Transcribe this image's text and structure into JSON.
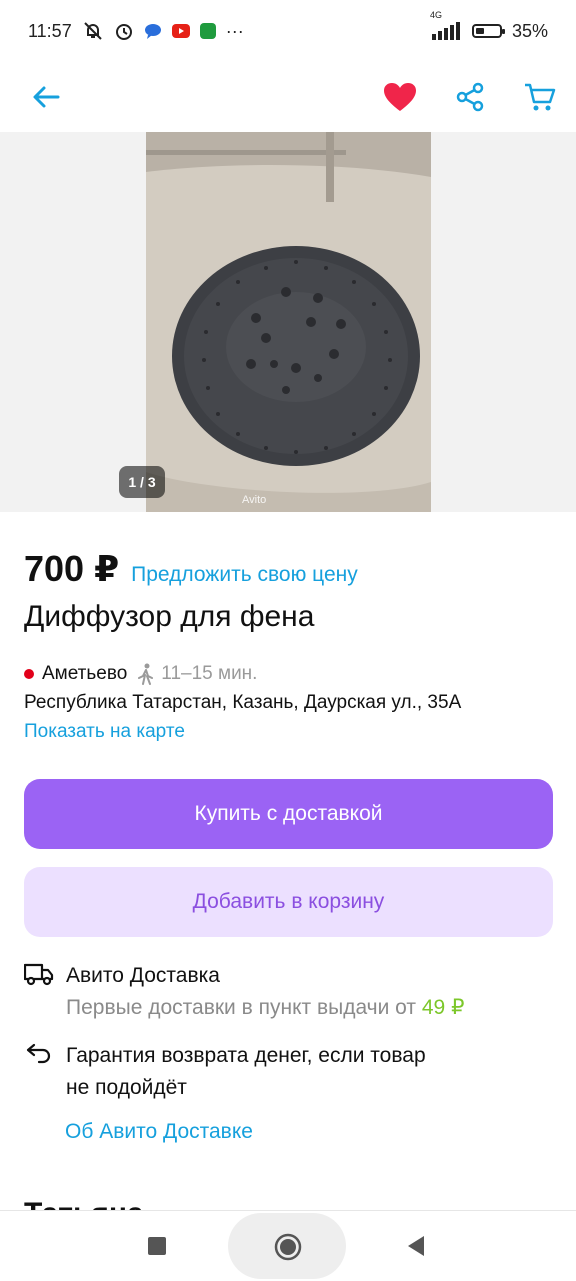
{
  "status_bar": {
    "time": "11:57",
    "dots": "···",
    "network": "4G",
    "battery_text": "35%",
    "battery_level": 0.35,
    "icons": [
      "muted-bell-icon",
      "alarm-icon",
      "chat-app-icon",
      "youtube-icon",
      "store-app-icon",
      "signal-icon",
      "battery-icon"
    ]
  },
  "top_nav": {
    "icons": [
      "back-arrow-icon",
      "heart-icon",
      "share-icon",
      "cart-icon"
    ],
    "accent_color": "#16a0dd",
    "favorite_color": "#f0254a"
  },
  "gallery": {
    "counter": "1 / 3",
    "watermark": "Avito"
  },
  "listing": {
    "price": "700 ₽",
    "offer_link": "Предложить свою цену",
    "title": "Диффузор для фена",
    "metro": "Аметьево",
    "walk_time": "11–15 мин.",
    "address": "Республика Татарстан, Казань, Даурская ул., 35А",
    "map_link": "Показать на карте"
  },
  "actions": {
    "buy_label": "Купить с доставкой",
    "cart_label": "Добавить в корзину",
    "primary_color": "#9b63f4",
    "secondary_color": "#ece0ff"
  },
  "delivery": {
    "title": "Авито Доставка",
    "subtitle_prefix": "Первые доставки в пункт выдачи от",
    "subtitle_price": "49 ₽",
    "guarantee_line1": "Гарантия возврата денег, если товар",
    "guarantee_line2": "не подойдёт",
    "about_link": "Об Авито Доставке"
  },
  "seller": {
    "name_peek": "Татьяна"
  }
}
